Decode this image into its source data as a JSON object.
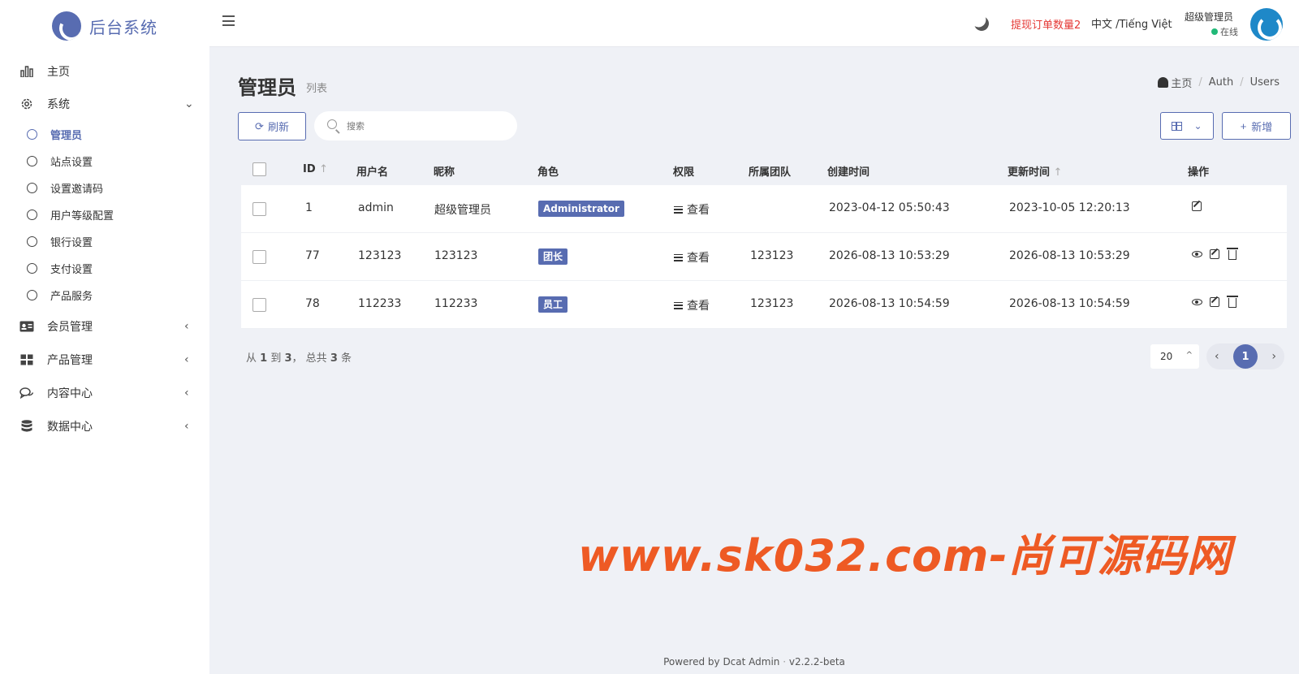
{
  "brand": {
    "name": "后台系统"
  },
  "sidebar": {
    "home": "主页",
    "system": "系统",
    "system_items": [
      "管理员",
      "站点设置",
      "设置邀请码",
      "用户等级配置",
      "银行设置",
      "支付设置",
      "产品服务"
    ],
    "member": "会员管理",
    "product": "产品管理",
    "content": "内容中心",
    "data": "数据中心"
  },
  "navbar": {
    "withdraw_notice": "提现订单数量2",
    "language": "中文 /Tiếng Việt",
    "user_name": "超级管理员",
    "user_status": "在线"
  },
  "page": {
    "title": "管理员",
    "subtitle": "列表"
  },
  "breadcrumb": [
    "主页",
    "Auth",
    "Users"
  ],
  "toolbar": {
    "refresh": "刷新",
    "search_placeholder": "搜索",
    "add": "新增"
  },
  "table": {
    "headers": [
      "ID",
      "用户名",
      "昵称",
      "角色",
      "权限",
      "所属团队",
      "创建时间",
      "更新时间",
      "操作"
    ],
    "view_label": "查看",
    "rows": [
      {
        "id": "1",
        "username": "admin",
        "nickname": "超级管理员",
        "role": "Administrator",
        "team": "",
        "created": "2023-04-12 05:50:43",
        "updated": "2023-10-05 12:20:13"
      },
      {
        "id": "77",
        "username": "123123",
        "nickname": "123123",
        "role": "团长",
        "team": "123123",
        "created": "2026-08-13 10:53:29",
        "updated": "2026-08-13 10:53:29"
      },
      {
        "id": "78",
        "username": "112233",
        "nickname": "112233",
        "role": "员工",
        "team": "123123",
        "created": "2026-08-13 10:54:59",
        "updated": "2026-08-13 10:54:59"
      }
    ]
  },
  "pagination": {
    "summary_from": "从",
    "from": "1",
    "to_word": "到",
    "to": "3",
    "total_word": "， 总共",
    "total": "3",
    "unit": "条",
    "per_page": "20",
    "current_page": "1"
  },
  "watermark": "www.sk032.com-尚可源码网",
  "footer": {
    "powered": "Powered by Dcat Admin",
    "version": "v2.2.2-beta"
  },
  "colors": {
    "accent": "#586cb1",
    "danger": "#e53935",
    "online": "#21b978",
    "watermark": "#ee5a24"
  }
}
